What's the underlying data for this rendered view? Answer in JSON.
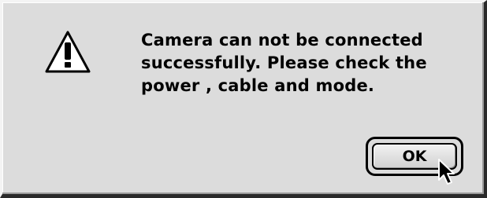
{
  "dialog": {
    "icon": "caution-triangle-icon",
    "message_lines": [
      "Camera can not be connected",
      "successfully.  Please check the",
      "power , cable and mode."
    ],
    "ok_label": "OK"
  },
  "cursor": {
    "icon": "arrow-cursor-icon"
  },
  "colors": {
    "dialog_background": "#dcdcdc",
    "text": "#000000"
  }
}
